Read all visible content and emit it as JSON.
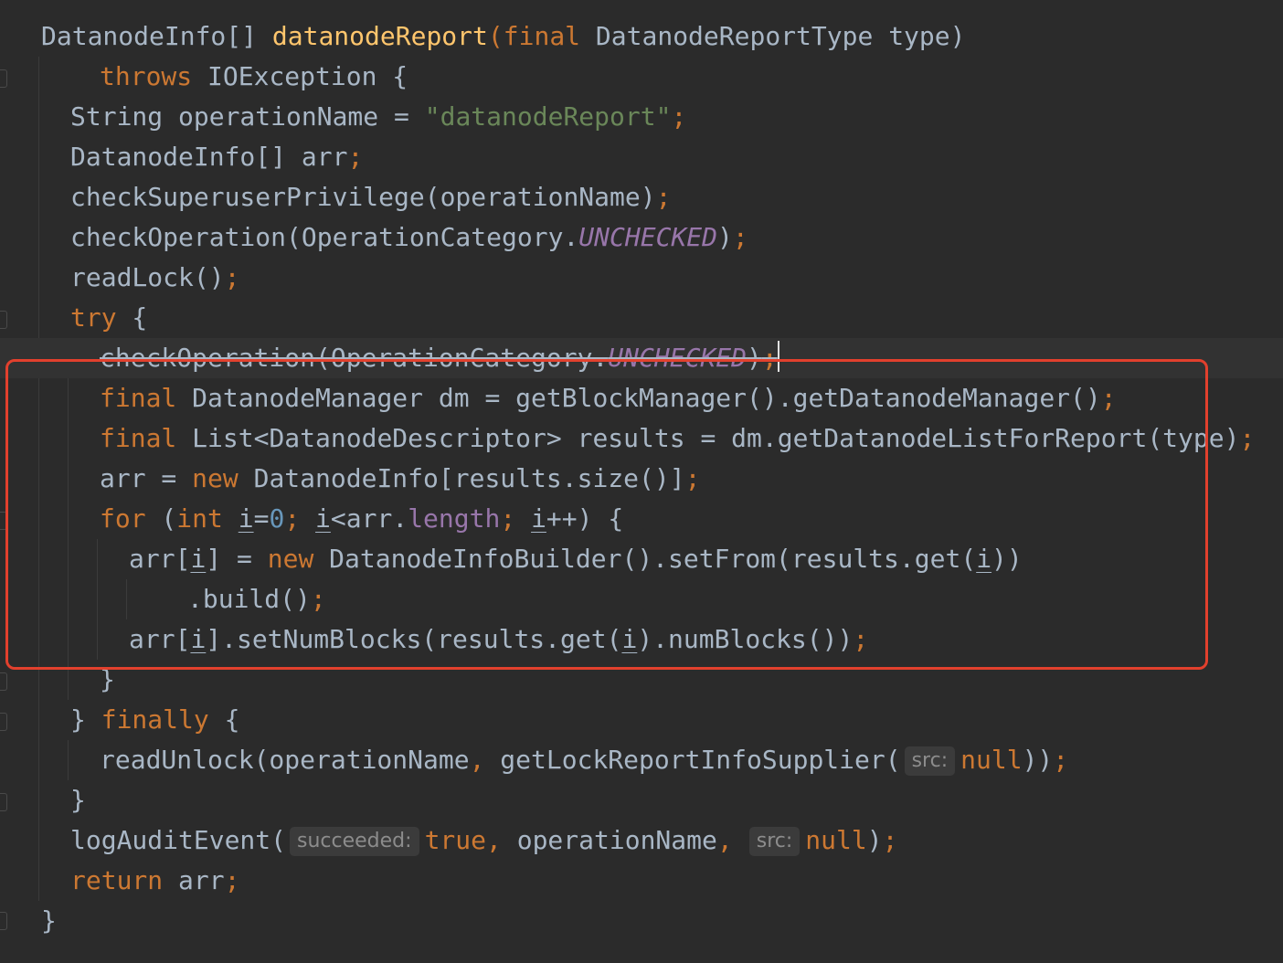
{
  "editor": {
    "highlight_color": "#e2402d",
    "colors": {
      "background": "#2b2b2b",
      "keyword": "#cc7832",
      "method_declaration": "#ffc66d",
      "string": "#6a8759",
      "number": "#6897bb",
      "field": "#9876aa",
      "plain": "#a9b7c6"
    },
    "code": {
      "l1": {
        "type": "DatanodeInfo[] ",
        "name": "datanodeReport",
        "open": "(",
        "kw": "final",
        "param": " DatanodeReportType type)"
      },
      "l2": {
        "kw": "throws",
        "rest": " IOException {"
      },
      "l3": {
        "a": "String operationName = ",
        "str": "\"datanodeReport\"",
        "semi": ";"
      },
      "l4": {
        "a": "DatanodeInfo[] arr",
        "semi": ";"
      },
      "l5": {
        "a": "checkSuperuserPrivilege(operationName)",
        "semi": ";"
      },
      "l6": {
        "a": "checkOperation(OperationCategory.",
        "cst": "UNCHECKED",
        "b": ")",
        "semi": ";"
      },
      "l7": {
        "a": "readLock()",
        "semi": ";"
      },
      "l8": {
        "kw": "try",
        "rest": " {"
      },
      "l9": {
        "a": "checkOperation(OperationCategory.",
        "cst": "UNCHECKED",
        "b": ")",
        "semi": ";"
      },
      "l10": {
        "kw": "final",
        "a": " DatanodeManager dm = getBlockManager().getDatanodeManager()",
        "semi": ";"
      },
      "l11": {
        "kw": "final",
        "a": " List<DatanodeDescriptor> results = dm.getDatanodeListForReport(type)",
        "semi": ";"
      },
      "l12": {
        "a": "arr = ",
        "kw": "new",
        "b": " DatanodeInfo[results.size()]",
        "semi": ";"
      },
      "l13": {
        "kw1": "for",
        "a": " (",
        "kw2": "int",
        "sp": " ",
        "v1": "i",
        "eq": "=",
        "num": "0",
        "semi1": ";",
        "sp2": " ",
        "v2": "i",
        "lt": "<arr.",
        "fld": "length",
        "semi2": ";",
        "sp3": " ",
        "v3": "i",
        "end": "++) {"
      },
      "l14": {
        "a": "arr[",
        "v1": "i",
        "b": "] = ",
        "kw": "new",
        "c": " DatanodeInfoBuilder().setFrom(results.get(",
        "v2": "i",
        "d": "))"
      },
      "l15": {
        "a": ".build()",
        "semi": ";"
      },
      "l16": {
        "a": "arr[",
        "v1": "i",
        "b": "].setNumBlocks(results.get(",
        "v2": "i",
        "c": ").numBlocks())",
        "semi": ";"
      },
      "l17": {
        "a": "}"
      },
      "l18": {
        "a": "} ",
        "kw": "finally",
        "b": " {"
      },
      "l19": {
        "a": "readUnlock(operationName",
        "comma": ",",
        "b": " getLockReportInfoSupplier(",
        "hint": "src:",
        "kw": "null",
        "c": "))",
        "semi": ";"
      },
      "l20": {
        "a": "}"
      },
      "l21": {
        "a": "logAuditEvent(",
        "hint1": "succeeded:",
        "kw1": "true",
        "comma1": ",",
        "b": " operationName",
        "comma2": ",",
        "hint2": "src:",
        "kw2": "null",
        "c": ")",
        "semi": ";"
      },
      "l22": {
        "kw": "return",
        "a": " arr",
        "semi": ";"
      },
      "l23": {
        "a": "}"
      }
    }
  }
}
